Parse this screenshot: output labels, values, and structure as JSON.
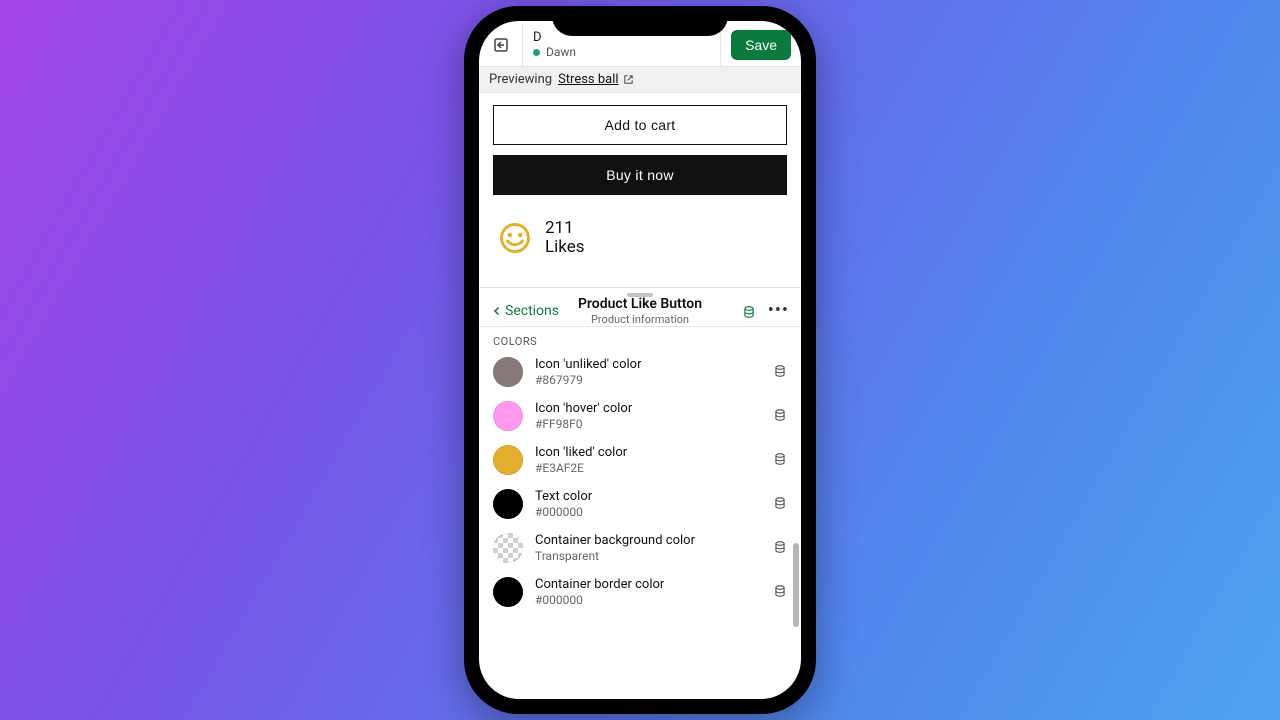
{
  "header": {
    "theme_letter": "D",
    "theme_name": "Dawn",
    "save_label": "Save"
  },
  "preview": {
    "label": "Previewing",
    "product_name": "Stress ball",
    "add_to_cart": "Add to cart",
    "buy_now": "Buy it now",
    "likes_count": "211",
    "likes_label": "Likes"
  },
  "panel": {
    "back_label": "Sections",
    "title": "Product Like Button",
    "subtitle": "Product information",
    "section_heading": "COLORS",
    "colors": [
      {
        "label": "Icon 'unliked' color",
        "value": "#867979",
        "swatch": "#867979"
      },
      {
        "label": "Icon 'hover' color",
        "value": "#FF98F0",
        "swatch": "#FF98F0"
      },
      {
        "label": "Icon 'liked' color",
        "value": "#E3AF2E",
        "swatch": "#E3AF2E"
      },
      {
        "label": "Text color",
        "value": "#000000",
        "swatch": "#000000"
      },
      {
        "label": "Container background color",
        "value": "Transparent",
        "swatch": "transparent"
      },
      {
        "label": "Container border color",
        "value": "#000000",
        "swatch": "#000000"
      }
    ]
  }
}
